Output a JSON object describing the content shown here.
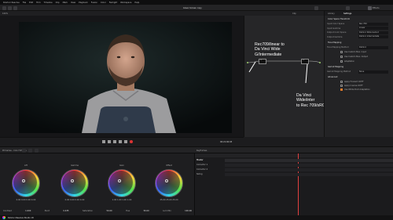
{
  "menubar": {
    "items": [
      "DaVinci Resolve",
      "File",
      "Edit",
      "Trim",
      "Timeline",
      "Clip",
      "Mark",
      "View",
      "Playback",
      "Fusion",
      "Color",
      "Fairlight",
      "Workspace",
      "Help"
    ]
  },
  "topbar": {
    "project_title": "Green Screen copy",
    "left_label": "100%",
    "clip_label": "Clip",
    "right_tabs": [
      "Effects",
      "Settings"
    ]
  },
  "viewer": {
    "timecode": "00:21:00:03",
    "zoom": "100%"
  },
  "node_editor": {
    "annotation_1": "Rec709/linear to\nDa Vinci Wide\nG/Intermediate",
    "annotation_2": "Da Vinci\nWide/inter\nto Rec 709/sRGB",
    "node_1_number": "01",
    "node_2_number": "02"
  },
  "inspector": {
    "tabs": [
      "Library",
      "Settings"
    ],
    "section_title": "Color Space Transform",
    "rows": [
      {
        "label": "Input Color Space",
        "value": "Rec.709"
      },
      {
        "label": "Input Gamma",
        "value": "Linear"
      },
      {
        "label": "Output Color Space",
        "value": "DaVinci Wide Gamut"
      },
      {
        "label": "Output Gamma",
        "value": "DaVinci Intermediate"
      }
    ],
    "tone_mapping_title": "Tone Mapping",
    "tone_rows": [
      {
        "label": "Tone Mapping Method",
        "value": "DaVinci"
      }
    ],
    "checks": [
      "Use Custom Max. Input",
      "Use Custom Max. Output",
      "Adaptation"
    ],
    "gamut_title": "Gamut Mapping",
    "gamut_rows": [
      {
        "label": "Gamut Mapping Method",
        "value": "None"
      }
    ],
    "advanced_title": "Advanced",
    "advanced_checks": [
      "Apply Forward OOTF",
      "Apply Inverse OOTF",
      "Use White Point Adaptation"
    ]
  },
  "panelbar": {
    "left_title": "Primaries - Color Wheels",
    "right_title": "Keyframes"
  },
  "wheels": [
    {
      "name": "Lift",
      "values": "0.00  0.00  0.00  0.00"
    },
    {
      "name": "Gamma",
      "values": "0.00  0.00  0.00  0.00"
    },
    {
      "name": "Gain",
      "values": "1.00  1.00  1.00  1.00"
    },
    {
      "name": "Offset",
      "values": "25.00  25.00  25.00"
    }
  ],
  "wheel_footer": [
    "Contrast",
    "1.000",
    "Pivot",
    "0.435",
    "Saturation",
    "50.00",
    "Hue",
    "50.00",
    "Lum Mix",
    "100.00"
  ],
  "keyframes": {
    "rows": [
      "Master",
      "Corrector 1",
      "Corrector 2",
      "Sizing"
    ]
  },
  "statusbar": {
    "app_name": "DaVinci Resolve Studio 18"
  }
}
